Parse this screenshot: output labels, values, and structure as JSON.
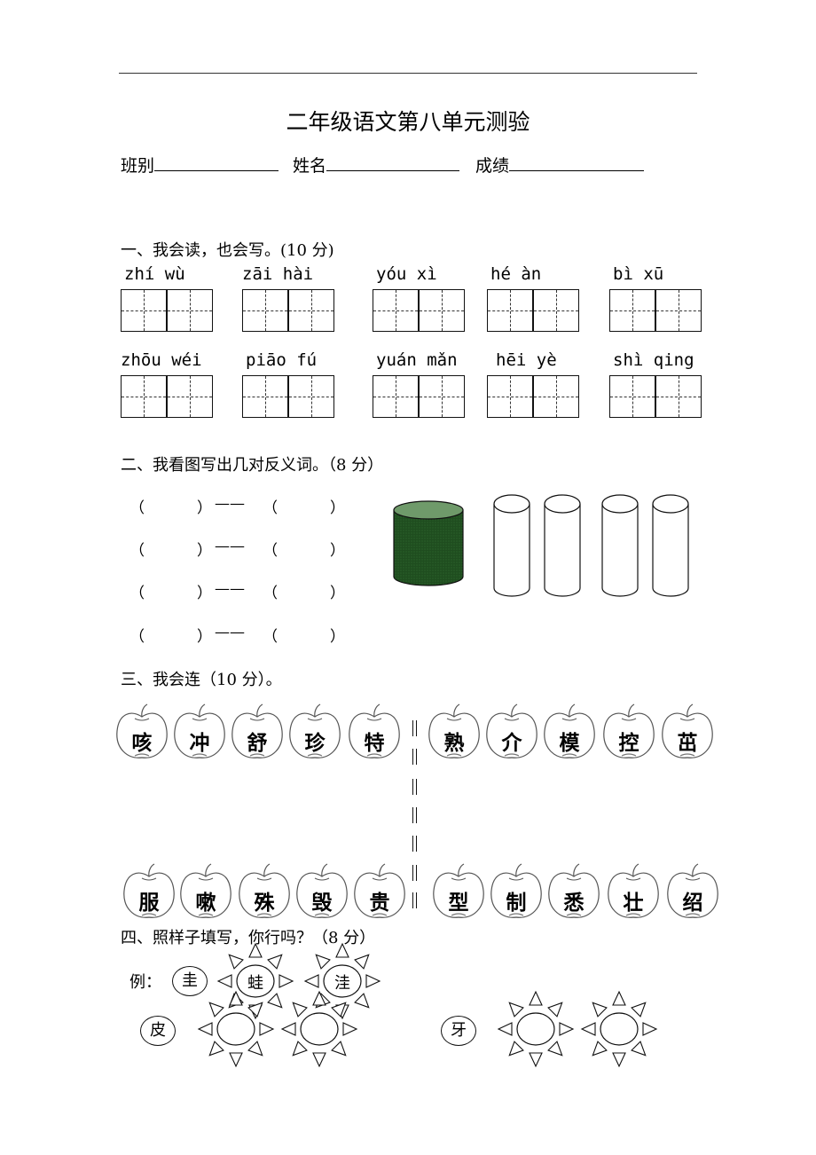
{
  "header": {
    "title": "二年级语文第八单元测验",
    "fields": [
      {
        "label": "班别"
      },
      {
        "label": "姓名"
      },
      {
        "label": "成绩"
      }
    ]
  },
  "section1": {
    "title": "一、我会读，也会写。(10 分)",
    "words": [
      {
        "pinyin": "zhí  wù"
      },
      {
        "pinyin": "zāi  hài"
      },
      {
        "pinyin": "yóu  xì"
      },
      {
        "pinyin": "hé  àn"
      },
      {
        "pinyin": "bì  xū"
      },
      {
        "pinyin": "zhōu wéi"
      },
      {
        "pinyin": "piāo fú"
      },
      {
        "pinyin": "yuán mǎn"
      },
      {
        "pinyin": "hēi  yè"
      },
      {
        "pinyin": "shì qing"
      }
    ]
  },
  "section2": {
    "title": "二、我看图写出几对反义词。（8 分）",
    "open_paren": "（",
    "close_paren": "）",
    "dash": "——",
    "rows": 4,
    "figures": [
      "dark-green-short-wide-cylinder",
      "white-tall-cylinder",
      "white-tall-cylinder",
      "white-tall-cylinder",
      "white-tall-cylinder"
    ],
    "colors": {
      "cylinder_fill": "#1f4d1f",
      "cylinder_top": "#6f9a6a"
    }
  },
  "section3": {
    "title": "三、我会连（10 分）。",
    "top_left": [
      "咳",
      "冲",
      "舒",
      "珍",
      "特"
    ],
    "top_right": [
      "熟",
      "介",
      "模",
      "控",
      "茁"
    ],
    "bottom_left": [
      "服",
      "嗽",
      "殊",
      "毁",
      "贵"
    ],
    "bottom_right": [
      "型",
      "制",
      "悉",
      "壮",
      "绍"
    ]
  },
  "section4": {
    "title": "四、照样子填写，你行吗？（8 分）",
    "example_label": "例：",
    "example_base": "圭",
    "example_answers": [
      "蛙",
      "洼"
    ],
    "tasks": [
      {
        "base": "皮",
        "answers": [
          "",
          ""
        ]
      },
      {
        "base": "牙",
        "answers": [
          "",
          ""
        ]
      }
    ]
  }
}
